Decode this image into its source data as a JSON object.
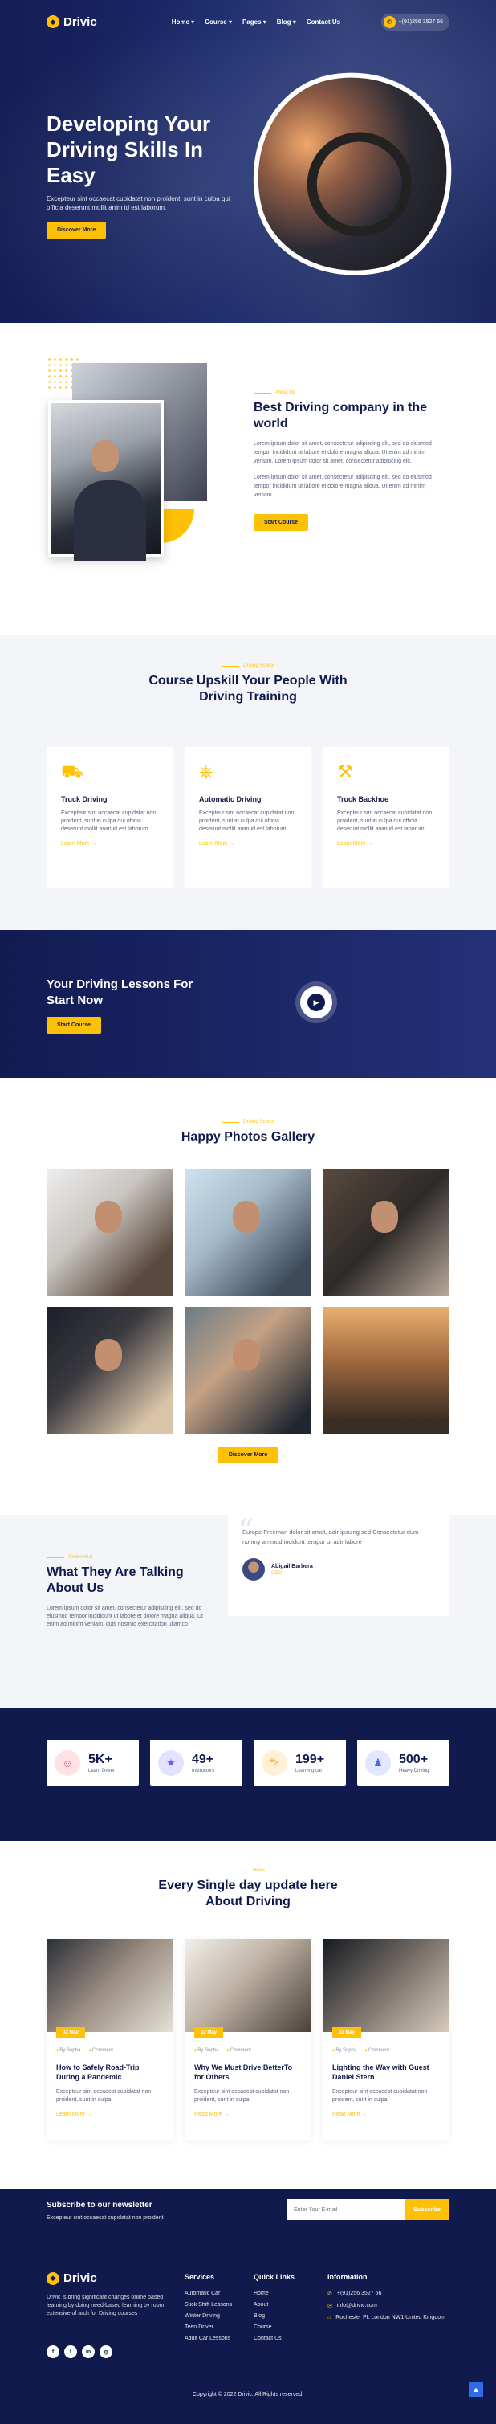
{
  "brand": {
    "name": "Drivic",
    "logo_icon": "helmet-icon"
  },
  "nav": {
    "items": [
      "Home ▾",
      "Course ▾",
      "Pages ▾",
      "Blog ▾",
      "Contact Us"
    ],
    "phone": "+(91)256 3527 56"
  },
  "hero": {
    "title": "Developing Your Driving Skills In Easy",
    "text": "Excepteur sint occaecat cupidatat non proident, sunt in culpa qui officia deserunt mollit anim id est laborum.",
    "button": "Discover More"
  },
  "about": {
    "eyebrow": "About Us",
    "title": "Best Driving company in the world",
    "p1": "Lorem ipsum dolor sit amet, consectetur adipiscing elit, sed do eiusmod tempor incididunt ut labore et dolore magna aliqua. Ut enim ad minim veniam, Lorem ipsum dolor sit amet, consectetur adipiscing elit.",
    "p2": "Lorem ipsum dolor sit amet, consectetur adipiscing elit, sed do eiusmod tempor incididunt ut labore et dolore magna aliqua. Ut enim ad minim veniam.",
    "button": "Start Course"
  },
  "courses": {
    "eyebrow": "Driving School",
    "title": "Course Upskill Your People With Driving Training",
    "items": [
      {
        "icon": "truck-icon",
        "title": "Truck Driving",
        "text": "Excepteur sint occaecat cupidatat non proident, sunt in culpa qui officia deserunt mollit anim id est laborum.",
        "link": "Learn More →"
      },
      {
        "icon": "steering-wheel-icon",
        "title": "Automatic Driving",
        "text": "Excepteur sint occaecat cupidatat non proident, sunt in culpa qui officia deserunt mollit anim id est laborum.",
        "link": "Learn More →"
      },
      {
        "icon": "backhoe-icon",
        "title": "Truck Backhoe",
        "text": "Excepteur sint occaecat cupidatat non proident, sunt in culpa qui officia deserunt mollit anim id est laborum.",
        "link": "Learn More →"
      }
    ]
  },
  "cta": {
    "title": "Your Driving Lessons For Start Now",
    "button": "Start Course"
  },
  "gallery": {
    "eyebrow": "Driving School",
    "title": "Happy Photos Gallery",
    "button": "Discover More"
  },
  "testimonial": {
    "eyebrow": "Testimonial",
    "title": "What They Are Talking About Us",
    "text": "Lorem ipsum dolor sit amet, consectetur adipiscing elit, sed do eiusmod tempor incididunt ut labore et dolore magna aliqua. Ut enim ad minim veniam, quis nostrud exercitation ullamco",
    "quote": "Europe Freeman dolor sit amet, adir ipsuing sed Consectetur dum nonmy ammod incidunt tempor ut adir labore",
    "name": "Abigail Barbera",
    "role": "CEO"
  },
  "stats": [
    {
      "icon": "user-icon",
      "color": "#ffe1e6",
      "ink": "#e8546e",
      "number": "5K+",
      "label": "Learn Driver"
    },
    {
      "icon": "star-icon",
      "color": "#e4e3ff",
      "ink": "#6a5df0",
      "number": "49+",
      "label": "Instructors"
    },
    {
      "icon": "car-icon",
      "color": "#fff0d8",
      "ink": "#f0a020",
      "number": "199+",
      "label": "Learning car"
    },
    {
      "icon": "person-icon",
      "color": "#e1e7ff",
      "ink": "#4a68e6",
      "number": "500+",
      "label": "Heavy Driving"
    }
  ],
  "blog": {
    "eyebrow": "News",
    "title": "Every Single day update here About Driving",
    "posts": [
      {
        "date": "02 May",
        "author": "By Sopha",
        "comments": "Comment",
        "title": "How to Safely Road-Trip During a Pandemic",
        "text": "Excepteur sint occaecat cupidatat non proident, sunt in culpa.",
        "link": "Learn More →"
      },
      {
        "date": "02 May",
        "author": "By Sopha",
        "comments": "Comment",
        "title": "Why We Must Drive BetterTo for Others",
        "text": "Excepteur sint occaecat cupidatat non proident, sunt in culpa.",
        "link": "Read More →"
      },
      {
        "date": "02 May",
        "author": "By Sopha",
        "comments": "Comment",
        "title": "Lighting the Way with Guest Daniel Stern",
        "text": "Excepteur sint occaecat cupidatat non proident, sunt in culpa.",
        "link": "Read More →"
      }
    ]
  },
  "footer": {
    "news_title": "Subscribe to our newsletter",
    "news_sub": "Excepteur sint occaecat cupidatat non proident",
    "email_placeholder": "Enter Your E-mail",
    "subscribe": "Subscribe",
    "about": "Drivic is bring significant changes online based learning by doing need-based learning by room extensive of arch for Driving courses",
    "services_title": "Services",
    "services": [
      "Automatic Car",
      "Stick Shift Lessons",
      "Winter Driving",
      "Teen Driver",
      "Adult Car Lessons"
    ],
    "links_title": "Quick Links",
    "links": [
      "Home",
      "About",
      "Blog",
      "Course",
      "Contact Us"
    ],
    "info_title": "Information",
    "info": [
      {
        "icon": "phone-icon",
        "text": "+(91)256 3527 56"
      },
      {
        "icon": "mail-icon",
        "text": "info@drivic.com"
      },
      {
        "icon": "location-icon",
        "text": "Rochester PL London NW1 United Kingdom"
      }
    ],
    "socials": [
      "f",
      "t",
      "in",
      "g"
    ],
    "copyright": "Copyright © 2022 Drivic. All Rights reserved."
  },
  "colors": {
    "accent": "#ffc107",
    "navy": "#111a4d"
  }
}
